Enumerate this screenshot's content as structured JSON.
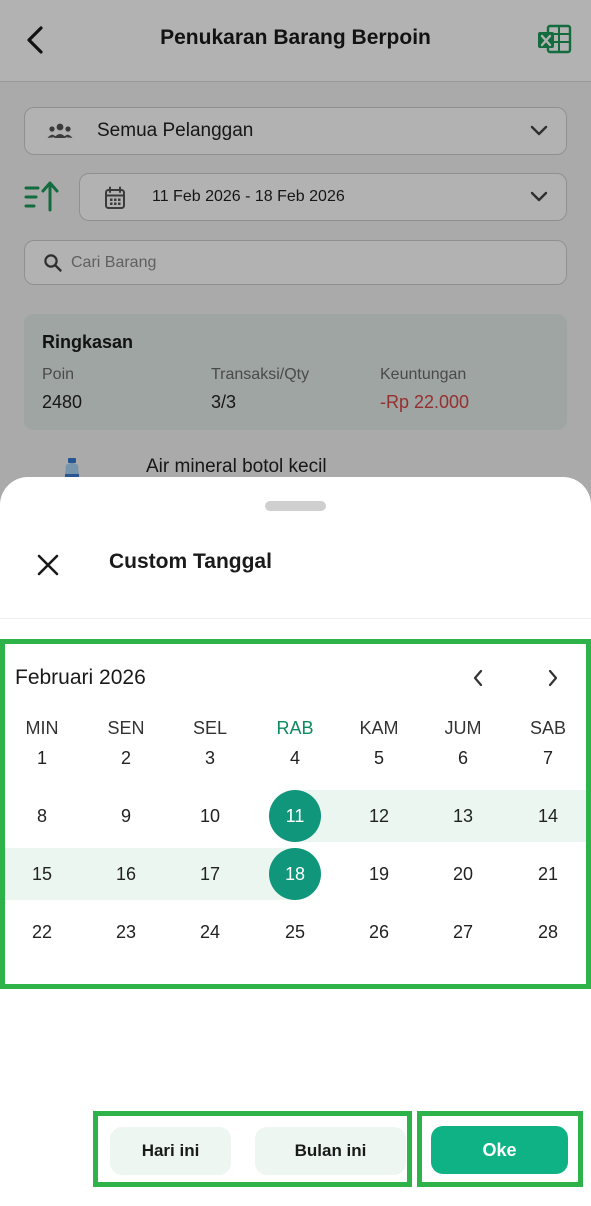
{
  "header": {
    "title": "Penukaran Barang Berpoin"
  },
  "filters": {
    "customer": "Semua Pelanggan",
    "date_range": "11 Feb 2026 - 18 Feb 2026",
    "search_placeholder": "Cari Barang"
  },
  "summary": {
    "title": "Ringkasan",
    "columns": [
      {
        "label": "Poin",
        "value": "2480"
      },
      {
        "label": "Transaksi/Qty",
        "value": "3/3"
      },
      {
        "label": "Keuntungan",
        "value": "-Rp 22.000"
      }
    ]
  },
  "product": {
    "name": "Air mineral botol kecil"
  },
  "sheet": {
    "title": "Custom Tanggal",
    "calendar": {
      "month": "Februari 2026",
      "weekdays": [
        "MIN",
        "SEN",
        "SEL",
        "RAB",
        "KAM",
        "JUM",
        "SAB"
      ],
      "highlighted_weekday": "RAB",
      "weeks": [
        [
          "1",
          "2",
          "3",
          "4",
          "5",
          "6",
          "7"
        ],
        [
          "8",
          "9",
          "10",
          "11",
          "12",
          "13",
          "14"
        ],
        [
          "15",
          "16",
          "17",
          "18",
          "19",
          "20",
          "21"
        ],
        [
          "22",
          "23",
          "24",
          "25",
          "26",
          "27",
          "28"
        ]
      ],
      "range_start": "11",
      "range_end": "18"
    },
    "buttons": {
      "today": "Hari ini",
      "this_month": "Bulan ini",
      "ok": "Oke"
    }
  },
  "colors": {
    "accent": "#0fb284",
    "selected": "#10967a",
    "negative": "#d64545",
    "annotation": "#2db34a"
  }
}
